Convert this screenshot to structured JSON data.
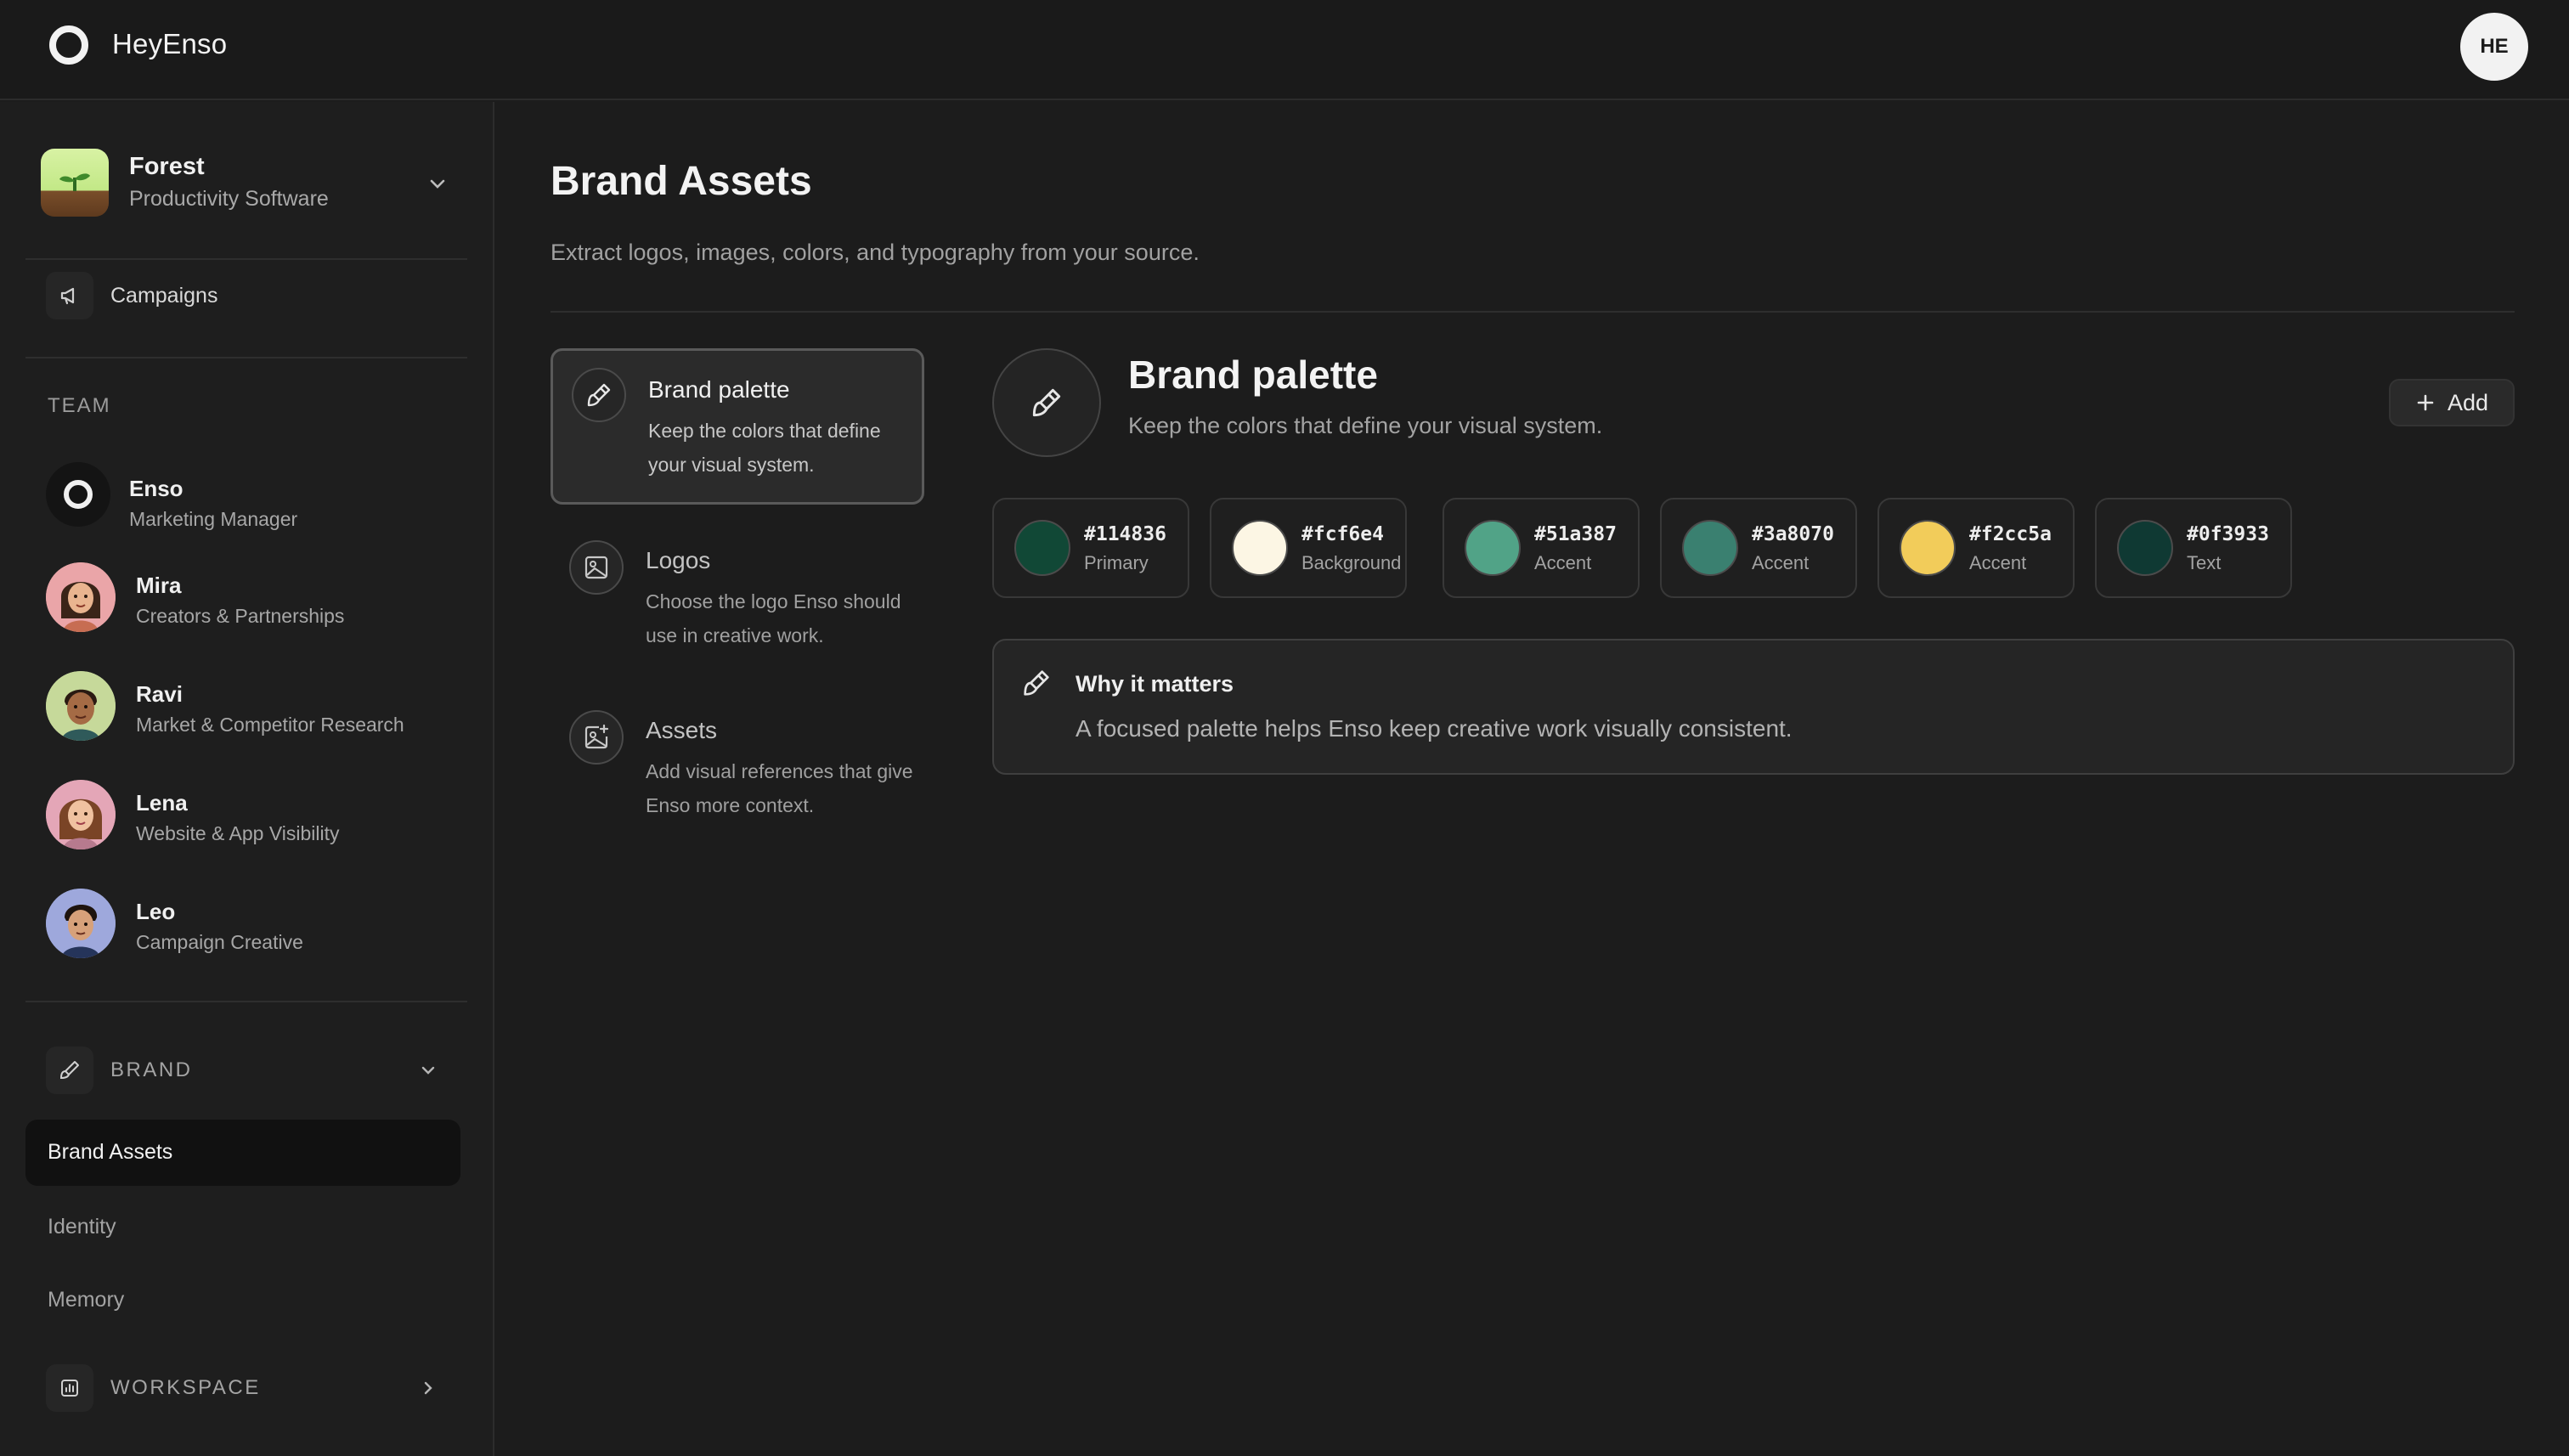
{
  "app": {
    "name": "HeyEnso",
    "user_initials": "HE"
  },
  "org": {
    "name": "Forest",
    "category": "Productivity Software"
  },
  "nav": {
    "campaigns_label": "Campaigns"
  },
  "team": {
    "section_label": "TEAM",
    "members": [
      {
        "name": "Enso",
        "role": "Marketing Manager"
      },
      {
        "name": "Mira",
        "role": "Creators & Partnerships"
      },
      {
        "name": "Ravi",
        "role": "Market & Competitor Research"
      },
      {
        "name": "Lena",
        "role": "Website & App Visibility"
      },
      {
        "name": "Leo",
        "role": "Campaign Creative"
      }
    ]
  },
  "brand_group": {
    "label": "BRAND",
    "items": [
      {
        "label": "Brand Assets",
        "active": true
      },
      {
        "label": "Identity",
        "active": false
      },
      {
        "label": "Memory",
        "active": false
      }
    ]
  },
  "workspace_group": {
    "label": "WORKSPACE"
  },
  "page": {
    "title": "Brand Assets",
    "subtitle": "Extract logos, images, colors, and typography from your source."
  },
  "categories": [
    {
      "title": "Brand palette",
      "description": "Keep the colors that define your visual system.",
      "icon": "paintbrush-icon"
    },
    {
      "title": "Logos",
      "description": "Choose the logo Enso should use in creative work.",
      "icon": "image-icon"
    },
    {
      "title": "Assets",
      "description": "Add visual references that give Enso more context.",
      "icon": "image-plus-icon"
    }
  ],
  "panel": {
    "title": "Brand palette",
    "subtitle": "Keep the colors that define your visual system.",
    "add_label": "Add",
    "swatches": [
      {
        "hex": "#114836",
        "role": "Primary"
      },
      {
        "hex": "#fcf6e4",
        "role": "Background"
      },
      {
        "hex": "#51a387",
        "role": "Accent"
      },
      {
        "hex": "#3a8070",
        "role": "Accent"
      },
      {
        "hex": "#f2cc5a",
        "role": "Accent"
      },
      {
        "hex": "#0f3933",
        "role": "Text"
      }
    ],
    "info": {
      "title": "Why it matters",
      "text": "A focused palette helps Enso keep creative work visually consistent."
    }
  }
}
